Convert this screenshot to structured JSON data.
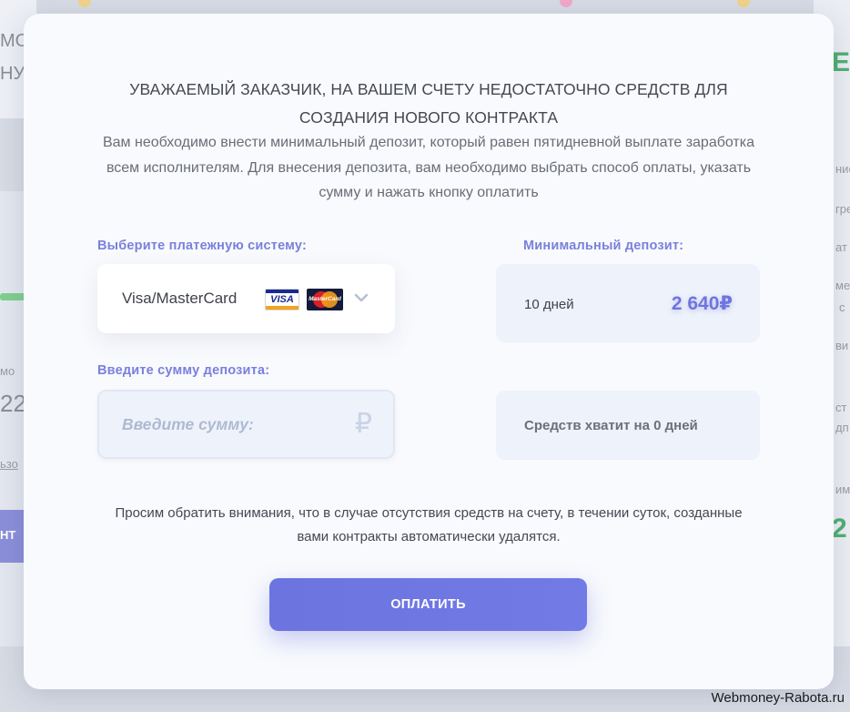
{
  "background": {
    "left_texts": [
      "МО",
      "НУ",
      "мо",
      "22",
      "ьзо",
      "НТ"
    ],
    "right_texts": [
      "Е",
      "",
      "нис",
      "гре",
      "ат",
      "ме",
      "с",
      "ви",
      "ст",
      "дп",
      "им",
      "2"
    ]
  },
  "modal": {
    "title": "УВАЖАЕМЫЙ ЗАКАЗЧИК, НА ВАШЕМ СЧЕТУ НЕДОСТАТОЧНО СРЕДСТВ ДЛЯ СОЗДАНИЯ НОВОГО КОНТРАКТА",
    "subtitle": "Вам необходимо внести минимальный депозит, который равен пятидневной выплате заработка всем исполнителям. Для внесения депозита, вам необходимо выбрать способ оплаты, указать сумму и нажать кнопку оплатить",
    "payment_label": "Выберите платежную систему:",
    "payment_selected": "Visa/MasterCard",
    "payment_icons": [
      "visa-icon",
      "mastercard-icon",
      "chevron-down-icon"
    ],
    "visa_text": "VISA",
    "mastercard_text": "MasterCard",
    "min_deposit_label": "Минимальный депозит:",
    "min_deposit_days": "10 дней",
    "min_deposit_amount": "2 640₽",
    "amount_label": "Введите сумму депозита:",
    "amount_placeholder": "Введите сумму:",
    "amount_value": "",
    "currency_symbol": "₽",
    "enough_text": "Средств хватит на 0 дней",
    "notice": "Просим обратить внимания, что в случае отсутствия средств на счету, в течении суток, созданные вами контракты автоматически удалятся.",
    "pay_button": "ОПЛАТИТЬ"
  },
  "watermark": "Webmoney-Rabota.ru",
  "colors": {
    "accent": "#6f75df",
    "label": "#7a80dc",
    "card_bg": "#edf2fb",
    "modal_bg": "#f8fafd"
  }
}
